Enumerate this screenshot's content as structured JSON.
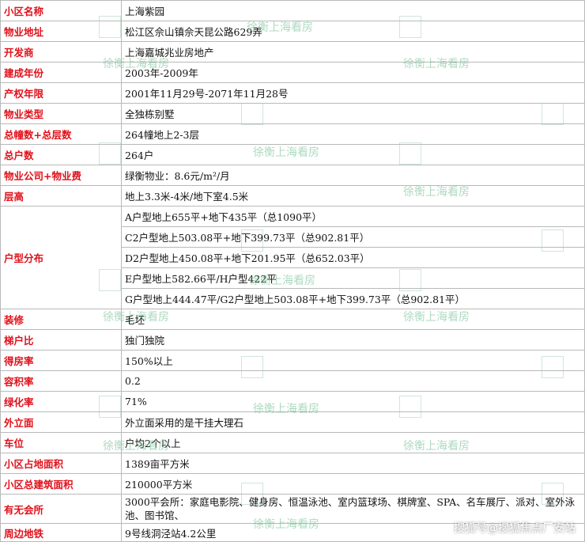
{
  "rows": [
    {
      "label": "小区名称",
      "value": "上海紫园"
    },
    {
      "label": "物业地址",
      "value": "松江区佘山镇佘天昆公路629弄"
    },
    {
      "label": "开发商",
      "value": "上海嘉城兆业房地产"
    },
    {
      "label": "建成年份",
      "value": "2003年-2009年"
    },
    {
      "label": "产权年限",
      "value": "2001年11月29号-2071年11月28号"
    },
    {
      "label": "物业类型",
      "value": "全独栋别墅"
    },
    {
      "label": "总幢数+总层数",
      "value": "264幢地上2-3层"
    },
    {
      "label": "总户数",
      "value": "264户"
    },
    {
      "label": "物业公司+物业费",
      "value": "绿衡物业：8.6元/m²/月"
    },
    {
      "label": "层高",
      "value": "地上3.3米-4米/地下室4.5米"
    }
  ],
  "layouts": {
    "label": "户型分布",
    "values": [
      "A户型地上655平+地下435平（总1090平）",
      "C2户型地上503.08平+地下399.73平（总902.81平）",
      "D2户型地上450.08平+地下201.95平（总652.03平）",
      "E户型地上582.66平/H户型422平",
      "G户型地上444.47平/G2户型地上503.08平+地下399.73平（总902.81平）"
    ]
  },
  "rows2": [
    {
      "label": "装修",
      "value": "毛坯"
    },
    {
      "label": "梯户比",
      "value": "独门独院"
    },
    {
      "label": "得房率",
      "value": "150%以上"
    },
    {
      "label": "容积率",
      "value": "0.2"
    },
    {
      "label": "绿化率",
      "value": "71%"
    },
    {
      "label": "外立面",
      "value": "外立面采用的是干挂大理石"
    },
    {
      "label": "车位",
      "value": "户均2个以上"
    },
    {
      "label": "小区占地面积",
      "value": "1389亩平方米"
    },
    {
      "label": "小区总建筑面积",
      "value": "210000平方米"
    },
    {
      "label": "有无会所",
      "value": "3000平会所：家庭电影院、健身房、恒温泳池、室内篮球场、棋牌室、SPA、名车展厅、派对、室外泳池、图书馆、"
    },
    {
      "label": "周边地铁",
      "value": "9号线洞泾站4.2公里"
    }
  ],
  "watermark": {
    "text": "徐衡上海看房",
    "color": "#69b98c"
  },
  "source_mark": "搜狐号@搜狐焦点厂安站"
}
